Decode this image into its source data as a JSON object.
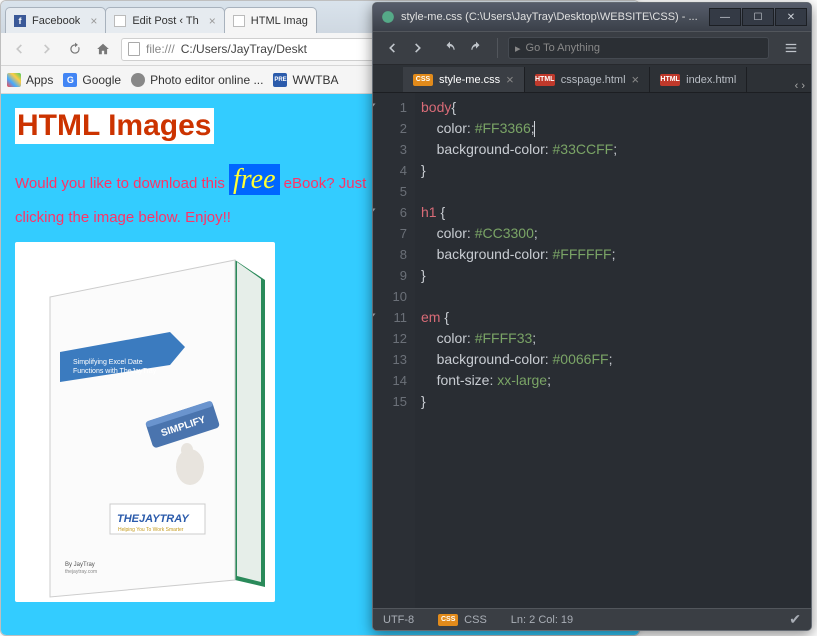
{
  "browser": {
    "tabs": [
      {
        "label": "Facebook",
        "icon": "facebook"
      },
      {
        "label": "Edit Post ‹ Th",
        "icon": "doc"
      },
      {
        "label": "HTML Imag",
        "icon": "doc"
      }
    ],
    "url_protocol": "file:///",
    "url_path": "C:/Users/JayTray/Deskt",
    "bookmarks": [
      {
        "label": "Apps"
      },
      {
        "label": "Google"
      },
      {
        "label": "Photo editor online ..."
      },
      {
        "label": "WWTBA"
      }
    ],
    "page": {
      "heading": "HTML Images",
      "para_a": "Would you like to download this ",
      "em": "free",
      "para_b": " eBook? Just",
      "para_c": "clicking the image below. Enjoy!!",
      "book_banner": "Simplifying Excel Date Functions with TheJayTray",
      "book_btn": "SIMPLIFY",
      "book_logo_a": "THEJAYTRAY",
      "book_logo_b": "Helping You To Work Smarter"
    }
  },
  "editor": {
    "title": "style-me.css (C:\\Users\\JayTray\\Desktop\\WEBSITE\\CSS) - ...",
    "goto_placeholder": "Go To Anything",
    "tabs": [
      {
        "type": "css",
        "label": "style-me.css",
        "active": true
      },
      {
        "type": "html",
        "label": "csspage.html",
        "active": false
      },
      {
        "type": "html",
        "label": "index.html",
        "active": false
      }
    ],
    "lines": [
      {
        "n": 1,
        "fold": true,
        "sel": "body",
        "rest": "{"
      },
      {
        "n": 2,
        "prop": "color",
        "val": "#FF3366"
      },
      {
        "n": 3,
        "prop": "background-color",
        "val": "#33CCFF"
      },
      {
        "n": 4,
        "close": true
      },
      {
        "n": 5,
        "blank": true
      },
      {
        "n": 6,
        "fold": true,
        "sel": "h1",
        "rest": " {"
      },
      {
        "n": 7,
        "prop": "color",
        "val": "#CC3300"
      },
      {
        "n": 8,
        "prop": "background-color",
        "val": "#FFFFFF"
      },
      {
        "n": 9,
        "close": true
      },
      {
        "n": 10,
        "blank": true
      },
      {
        "n": 11,
        "fold": true,
        "sel": "em",
        "rest": " {"
      },
      {
        "n": 12,
        "prop": "color",
        "val": "#FFFF33"
      },
      {
        "n": 13,
        "prop": "background-color",
        "val": "#0066FF"
      },
      {
        "n": 14,
        "prop": "font-size",
        "val": "xx-large"
      },
      {
        "n": 15,
        "close": true
      }
    ],
    "status": {
      "enc": "UTF-8",
      "lang": "CSS",
      "pos": "Ln: 2 Col: 19"
    }
  }
}
